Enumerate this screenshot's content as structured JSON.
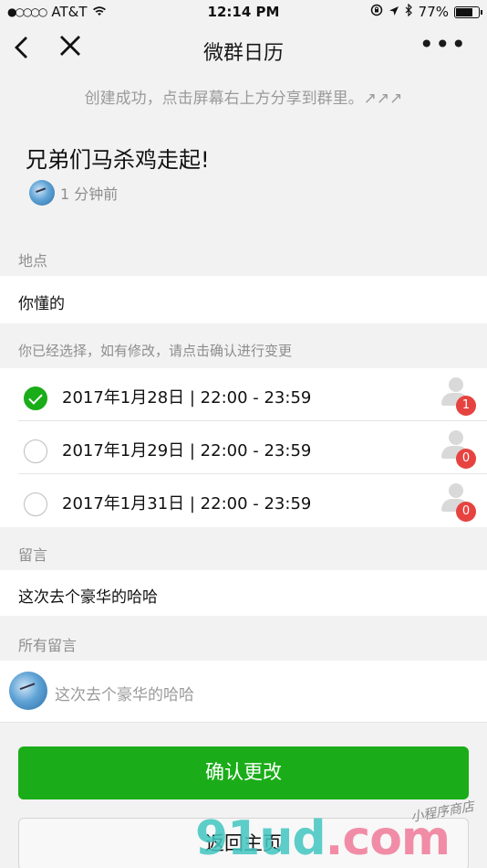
{
  "status_bar": {
    "signal": "●○○○○",
    "carrier": "AT&T",
    "wifi_icon": "wifi",
    "time": "12:14 PM",
    "lock_icon": "rotation-lock",
    "location_icon": "location-arrow",
    "bluetooth_icon": "bluetooth",
    "battery": "77%",
    "battery_level": 0.77
  },
  "nav": {
    "back_glyph": "‹",
    "close_glyph": "✕",
    "title": "微群日历",
    "more_glyph": "•••"
  },
  "hint": "创建成功，点击屏幕右上方分享到群里。↗↗↗",
  "event": {
    "title": "兄弟们马杀鸡走起!",
    "created_ago": "1 分钟前"
  },
  "location": {
    "label": "地点",
    "value": "你懂的"
  },
  "selection": {
    "label": "你已经选择，如有修改，请点击确认进行变更",
    "options": [
      {
        "datetime": "2017年1月28日 | 22:00 - 23:59",
        "selected": true,
        "count": "1"
      },
      {
        "datetime": "2017年1月29日 | 22:00 - 23:59",
        "selected": false,
        "count": "0"
      },
      {
        "datetime": "2017年1月31日 | 22:00 - 23:59",
        "selected": false,
        "count": "0"
      }
    ]
  },
  "message": {
    "label": "留言",
    "value": "这次去个豪华的哈哈"
  },
  "all_messages": {
    "label": "所有留言",
    "items": [
      {
        "text": "这次去个豪华的哈哈"
      }
    ]
  },
  "buttons": {
    "confirm": "确认更改",
    "home": "返回主页"
  },
  "watermark": {
    "main": "91ud",
    "dot": ".com",
    "sub": "小程序商店"
  },
  "colors": {
    "primary_green": "#1aad19",
    "badge_red": "#e64340",
    "background": "#f2f2f2"
  }
}
